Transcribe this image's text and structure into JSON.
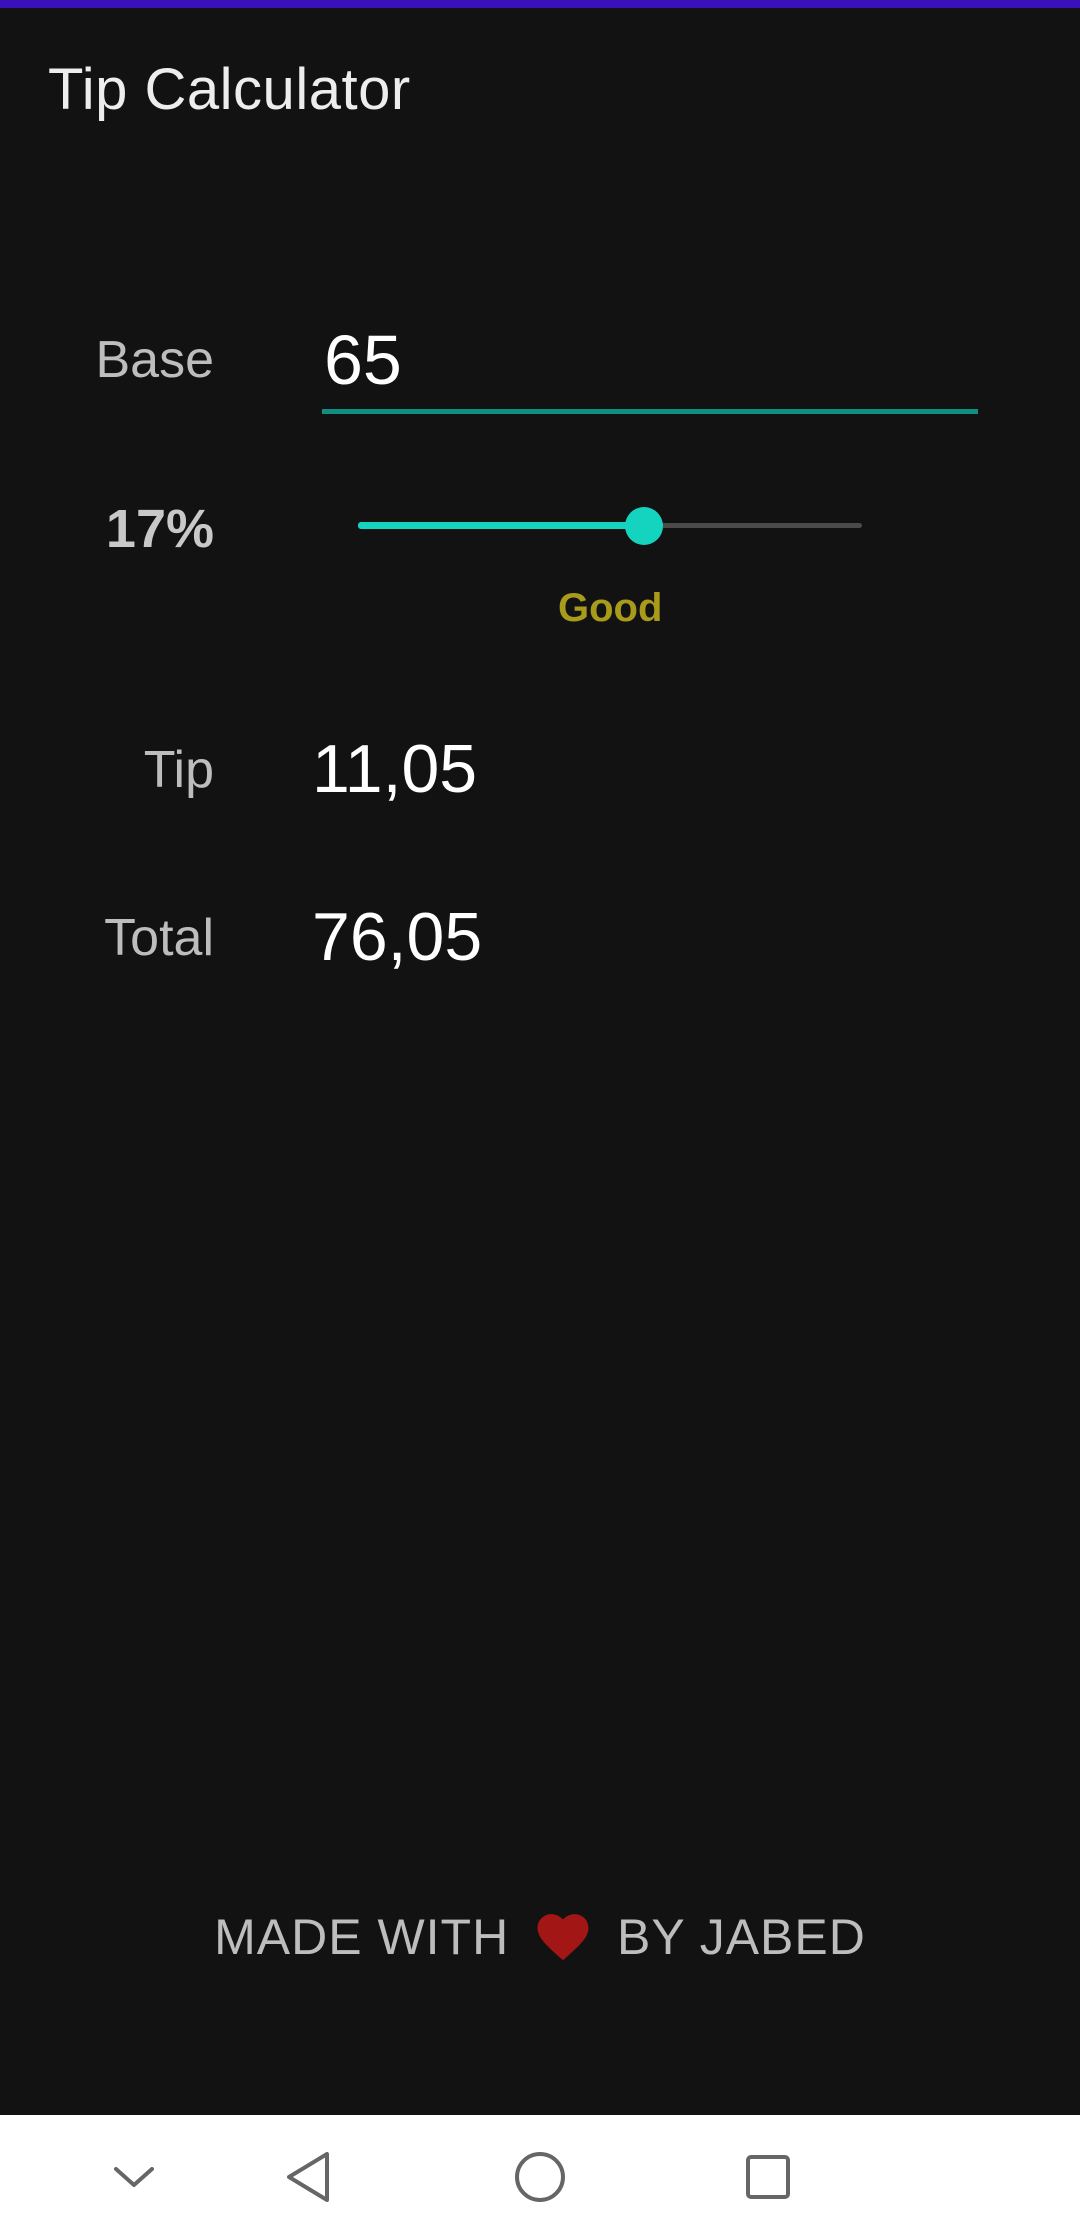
{
  "app": {
    "title": "Tip Calculator",
    "accent_color": "#15d4bf",
    "status_bar_color": "#3a10b8"
  },
  "form": {
    "base_label": "Base",
    "base_value": "65",
    "tip_percent_label": "17%",
    "tip_percent_value": 17,
    "slider_max": 30,
    "tip_quality": "Good",
    "tip_label": "Tip",
    "tip_amount": "11,05",
    "total_label": "Total",
    "total_amount": "76,05"
  },
  "footer": {
    "before": "MADE WITH",
    "icon": "heart-icon",
    "after": "BY JABED"
  },
  "nav_bar": {
    "buttons": [
      "hide-keyboard-icon",
      "back-icon",
      "home-icon",
      "recents-icon"
    ]
  }
}
